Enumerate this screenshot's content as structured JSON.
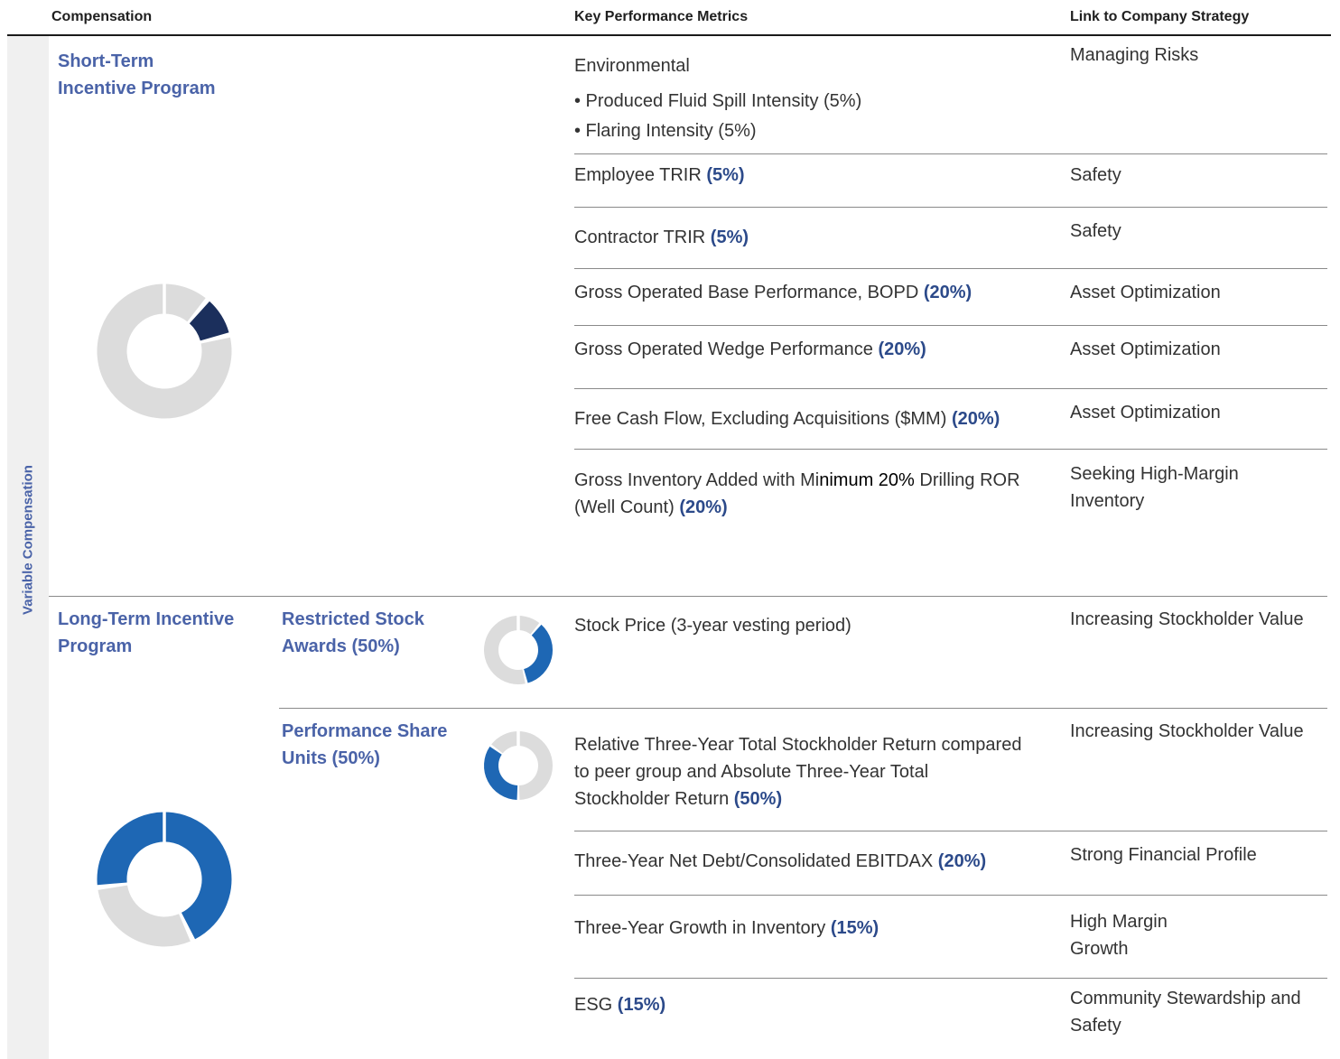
{
  "header": {
    "compensation": "Compensation",
    "metrics": "Key Performance Metrics",
    "strategy": "Link to Company Strategy"
  },
  "sidebar": {
    "label": "Variable Compensation"
  },
  "short_term": {
    "program_line1": "Short-Term",
    "program_line2": "Incentive Program",
    "donut_highlight_fraction": 0.1,
    "rows": [
      {
        "title": "Environmental",
        "bullets": [
          "• Produced Fluid Spill Intensity (5%)",
          "• Flaring Intensity (5%)"
        ],
        "strategy": "Managing Risks"
      },
      {
        "metric": "Employee TRIR ",
        "pct": "(5%)",
        "strategy": "Safety"
      },
      {
        "metric": "Contractor TRIR ",
        "pct": "(5%)",
        "strategy": "Safety"
      },
      {
        "metric": "Gross Operated Base Performance, BOPD ",
        "pct": "(20%)",
        "strategy": "Asset Optimization"
      },
      {
        "metric": "Gross Operated Wedge Performance ",
        "pct": "(20%)",
        "strategy": "Asset Optimization"
      },
      {
        "metric": "Free Cash Flow, Excluding Acquisitions ($MM) ",
        "pct": "(20%)",
        "strategy": "Asset Optimization"
      },
      {
        "metric_a": "Gross Inventory Added with Mi",
        "metric_b": "nimum 20%",
        "metric_c": " Drilling ROR",
        "metric_d": "(Well Count) ",
        "pct": "(20%)",
        "strategy_line1": "Seeking High-Margin",
        "strategy_line2": "Inventory"
      }
    ]
  },
  "long_term": {
    "program_line1": "Long-Term Incentive",
    "program_line2": "Program",
    "donut_highlight_fraction": 0.7,
    "rsa": {
      "label_line1": "Restricted Stock",
      "label_line2": "Awards (50%)",
      "donut_highlight_fraction": 0.35,
      "metric": "Stock Price (3-year vesting period)",
      "strategy": "Increasing Stockholder Value"
    },
    "psu": {
      "label_line1": "Performance Share",
      "label_line2": "Units (50%)",
      "donut_highlight_fraction": 0.35,
      "rows": [
        {
          "metric_line1": "Relative Three-Year Total Stockholder Return compared",
          "metric_line2": "to peer group and Absolute Three-Year Total",
          "metric_line3": "Stockholder Return ",
          "pct": "(50%)",
          "strategy": "Increasing Stockholder Value"
        },
        {
          "metric": "Three-Year Net Debt/Consolidated EBITDAX ",
          "pct": "(20%)",
          "strategy": "Strong Financial Profile"
        },
        {
          "metric": "Three-Year Growth in Inventory ",
          "pct": "(15%)",
          "strategy_line1": "High Margin",
          "strategy_line2": "Growth"
        },
        {
          "metric": "ESG ",
          "pct": "(15%)",
          "strategy_line1": "Community Stewardship and",
          "strategy_line2": "Safety"
        }
      ]
    }
  },
  "colors": {
    "accent_text": "#4a63a8",
    "pct_text": "#2c4a8a",
    "donut_gray": "#dcdcdc",
    "donut_navy": "#1b2f5c",
    "donut_blue": "#1e67b4"
  }
}
